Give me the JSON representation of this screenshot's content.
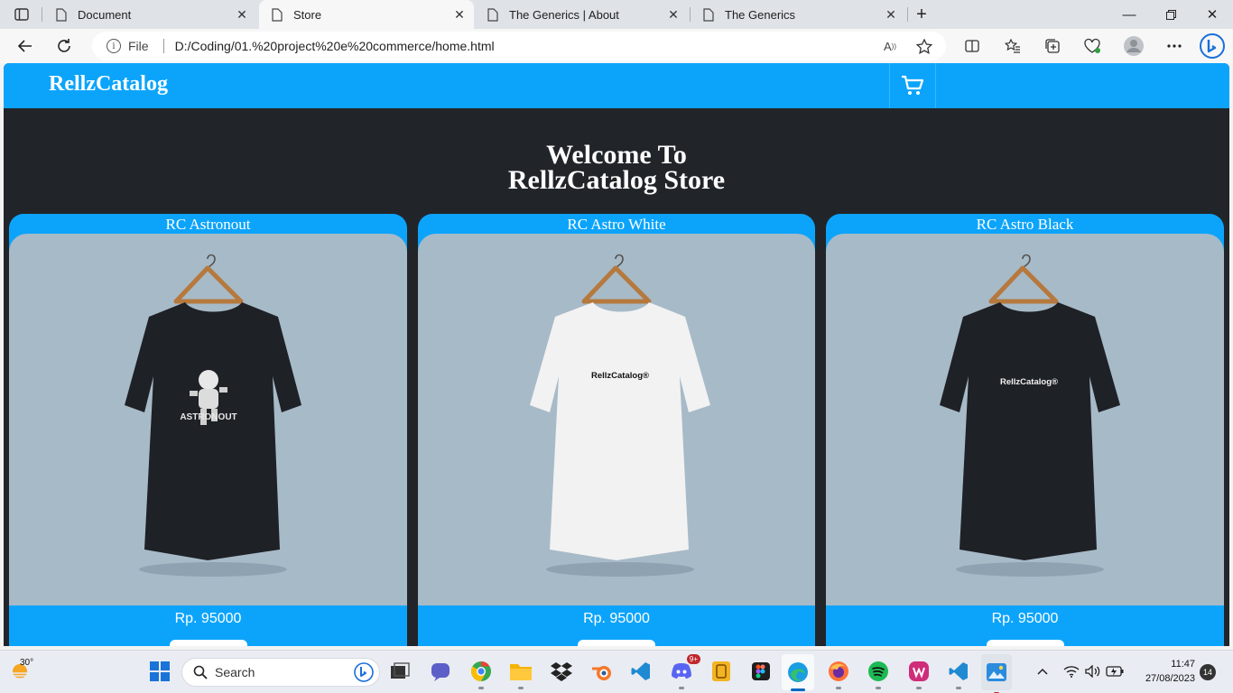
{
  "browser": {
    "tabs": [
      {
        "title": "Document",
        "active": false
      },
      {
        "title": "Store",
        "active": true
      },
      {
        "title": "The Generics | About",
        "active": false
      },
      {
        "title": "The Generics",
        "active": false
      }
    ],
    "address": {
      "scheme_label": "File",
      "url": "D:/Coding/01.%20project%20e%20commerce/home.html"
    }
  },
  "page": {
    "brand": "RellzCatalog",
    "hero_line1": "Welcome To",
    "hero_line2": "RellzCatalog Store",
    "products": [
      {
        "name": "RC Astronout",
        "price": "Rp. 95000",
        "shirt_color": "#1e2126",
        "print_text": "ASTRONOUT"
      },
      {
        "name": "RC Astro White",
        "price": "Rp. 95000",
        "shirt_color": "#f2f2f2",
        "print_text": "RellzCatalog®"
      },
      {
        "name": "RC Astro Black",
        "price": "Rp. 95000",
        "shirt_color": "#1e2126",
        "print_text": "RellzCatalog®"
      }
    ]
  },
  "taskbar": {
    "weather_temp": "30°",
    "search_label": "Search",
    "discord_badge": "9+",
    "time": "11:47",
    "date": "27/08/2023",
    "notification_count": "14"
  },
  "colors": {
    "navbar": "#0ca4fb",
    "page_bg": "#212529",
    "product_img_bg": "#a7bac8"
  }
}
